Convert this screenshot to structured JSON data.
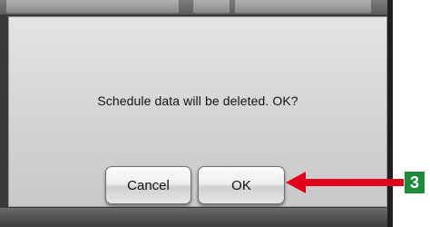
{
  "dialog": {
    "message": "Schedule data will be deleted. OK?",
    "cancel_label": "Cancel",
    "ok_label": "OK"
  },
  "annotation": {
    "step_number": "3",
    "arrow_color": "#e0001b",
    "badge_color": "#1f8a3a"
  }
}
